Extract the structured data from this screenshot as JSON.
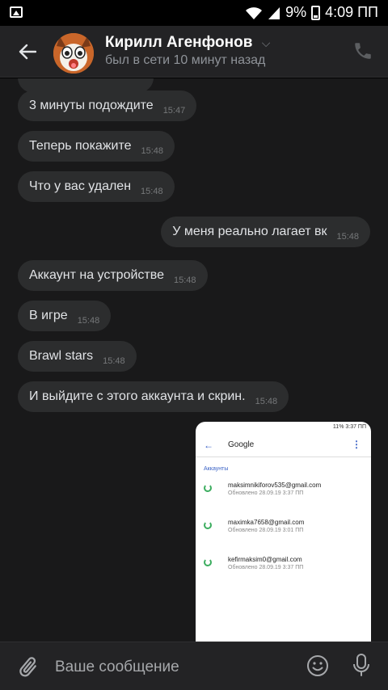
{
  "status_bar": {
    "battery": "9%",
    "time": "4:09 ПП"
  },
  "header": {
    "name": "Кирилл Агенфонов",
    "status": "был в сети 10 минут назад"
  },
  "messages": [
    {
      "text": "3 минуты подождите",
      "time": "15:47",
      "direction": "in"
    },
    {
      "text": "Теперь покажите",
      "time": "15:48",
      "direction": "in"
    },
    {
      "text": "Что у вас удален",
      "time": "15:48",
      "direction": "in"
    },
    {
      "text": "У меня реально лагает вк",
      "time": "15:48",
      "direction": "out"
    },
    {
      "text": "Аккаунт на устройстве",
      "time": "15:48",
      "direction": "in"
    },
    {
      "text": "В игре",
      "time": "15:48",
      "direction": "in"
    },
    {
      "text": "Brawl stars",
      "time": "15:48",
      "direction": "in"
    },
    {
      "text": "И выйдите с этого аккаунта и скрин.",
      "time": "15:48",
      "direction": "in"
    }
  ],
  "attachment": {
    "status_text": "11% 3:37 ПП",
    "title": "Google",
    "section": "Аккаунты",
    "accounts": [
      {
        "email": "maksimnikiforov535@gmail.com",
        "updated": "Обновлено 28.09.19 3:37 ПП"
      },
      {
        "email": "maximka7658@gmail.com",
        "updated": "Обновлено 28.09.19 3:01 ПП"
      },
      {
        "email": "kefirmaksim0@gmail.com",
        "updated": "Обновлено 28.09.19 3:37 ПП"
      }
    ]
  },
  "composer": {
    "placeholder": "Ваше сообщение"
  },
  "colors": {
    "background": "#19191a",
    "bubble": "#2c2d2e",
    "header": "#232325",
    "sync_green": "#3cad5f"
  }
}
